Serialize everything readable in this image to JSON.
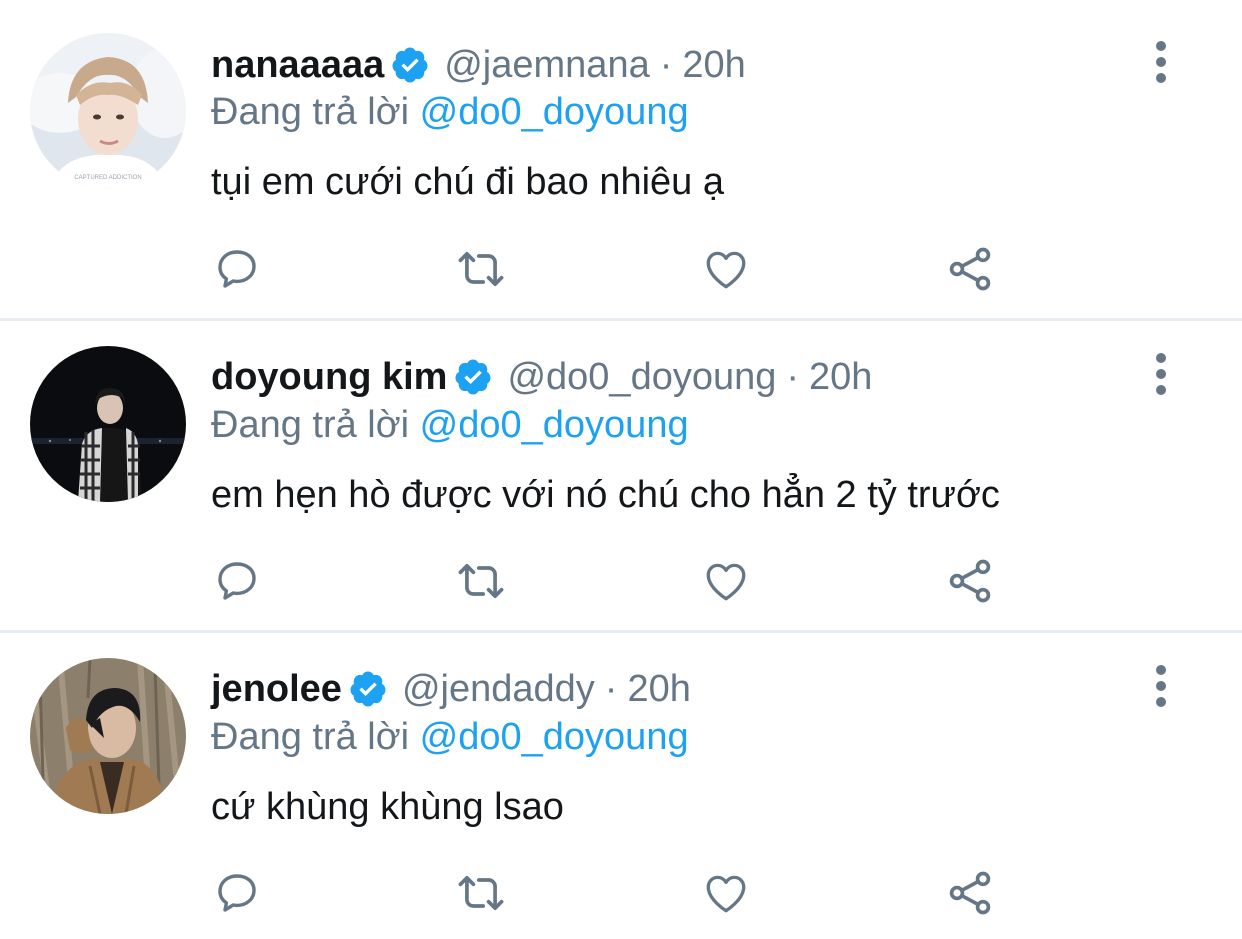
{
  "colors": {
    "text": "#14171a",
    "secondary": "#657786",
    "accent": "#1da1f2",
    "icon": "#657786",
    "divider": "#e6ecf0"
  },
  "tweets": [
    {
      "name": "nanaaaaa",
      "verified": true,
      "handle": "@jaemnana",
      "separator": "·",
      "time": "20h",
      "reply_prefix": "Đang trả lời",
      "reply_to": "@do0_doyoung",
      "text": "tụi em cưới chú đi bao nhiêu ạ",
      "avatar_watermark": "CAPTURED ADDICTION"
    },
    {
      "name": "doyoung kim",
      "verified": true,
      "handle": "@do0_doyoung",
      "separator": "·",
      "time": "20h",
      "reply_prefix": "Đang trả lời",
      "reply_to": "@do0_doyoung",
      "text": "em hẹn hò được với nó chú cho hẳn 2 tỷ trước"
    },
    {
      "name": "jenolee",
      "verified": true,
      "handle": "@jendaddy",
      "separator": "·",
      "time": "20h",
      "reply_prefix": "Đang trả lời",
      "reply_to": "@do0_doyoung",
      "text": "cứ khùng khùng lsao"
    }
  ],
  "icons": {
    "more": "more-vertical-icon",
    "reply": "reply-bubble-icon",
    "retweet": "retweet-icon",
    "like": "heart-icon",
    "share": "share-icon",
    "verified": "verified-badge-icon"
  }
}
